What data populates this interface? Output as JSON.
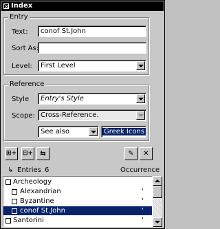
{
  "window": {
    "title": "Index"
  },
  "entry": {
    "legend": "Entry",
    "text_label": "Text:",
    "text_value": "conof St.John",
    "sort_label": "Sort As:",
    "sort_value": "",
    "level_label": "Level:",
    "level_value": "First Level"
  },
  "reference": {
    "legend": "Reference",
    "style_label": "Style",
    "style_value": "Entry's Style",
    "scope_label": "Scope:",
    "scope_value": "Cross-Reference.",
    "crossref_type_value": "See also",
    "crossref_target_value": "Greek Icons"
  },
  "toolbar": {
    "btn1_label": "⊞+",
    "btn2_label": "⊟+",
    "btn3_label": "⇆",
    "btn4_label": "✎",
    "btn5_label": "✕"
  },
  "list": {
    "entries_label": "Entries",
    "entries_count": "6",
    "occurrence_label": "Occurrence",
    "rows": [
      {
        "text": "Archeology",
        "occ": "",
        "depth": 0,
        "selected": false
      },
      {
        "text": "Alexandrian",
        "occ": "'",
        "depth": 1,
        "selected": false
      },
      {
        "text": "Byzantine",
        "occ": "'",
        "depth": 1,
        "selected": false
      },
      {
        "text": "conof St.John",
        "occ": "'",
        "depth": 1,
        "selected": true
      },
      {
        "text": "Santorini",
        "occ": "'",
        "depth": 0,
        "selected": false
      }
    ]
  },
  "colors": {
    "titlebar": "#000000",
    "selection": "#0a246a",
    "face": "#c8c8c8"
  },
  "icons": {
    "window_close": "close-icon",
    "dropdown": "chevron-down-icon",
    "tree_toggle": "tree-expander-icon"
  }
}
